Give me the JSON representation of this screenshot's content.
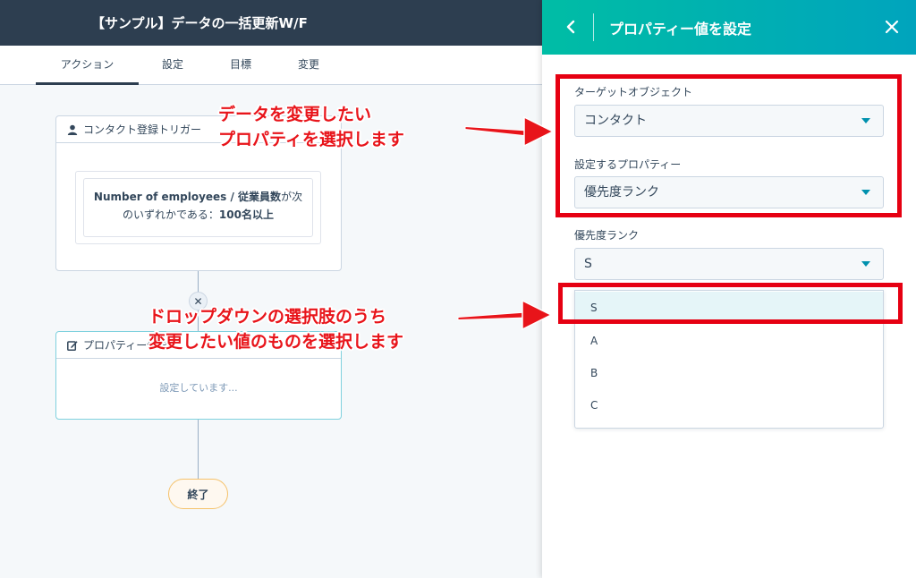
{
  "header": {
    "workflow_title": "【サンプル】データの一括更新W/F"
  },
  "tabs": [
    {
      "label": "アクション",
      "active": true
    },
    {
      "label": "設定",
      "active": false
    },
    {
      "label": "目標",
      "active": false
    },
    {
      "label": "変更",
      "active": false
    }
  ],
  "canvas": {
    "trigger_card": {
      "title": "コンタクト登録トリガー",
      "condition_prop": "Number of employees / 従業員数",
      "condition_mid": "が次のいずれかである：",
      "condition_value": "100名以上"
    },
    "action_card": {
      "title": "プロパティー値を",
      "body": "設定しています..."
    },
    "end_label": "終了"
  },
  "annotations": {
    "first": {
      "line1": "データを変更したい",
      "line2": "プロパティを選択します"
    },
    "second": {
      "line1": "ドロップダウンの選択肢のうち",
      "line2": "変更したい値のものを選択します"
    },
    "color": "#e8141a"
  },
  "panel": {
    "title": "プロパティー値を設定",
    "object_label": "ターゲットオブジェクト",
    "object_value": "コンタクト",
    "property_label": "設定するプロパティー",
    "property_value": "優先度ランク",
    "value_label": "優先度ランク",
    "value_selected": "S",
    "options": [
      "S",
      "A",
      "B",
      "C"
    ]
  },
  "colors": {
    "header_bg": "#2d3e50",
    "panel_header_start": "#00bda5",
    "panel_header_end": "#00a4bd",
    "highlight": "#e60012",
    "accent": "#0091ae"
  }
}
